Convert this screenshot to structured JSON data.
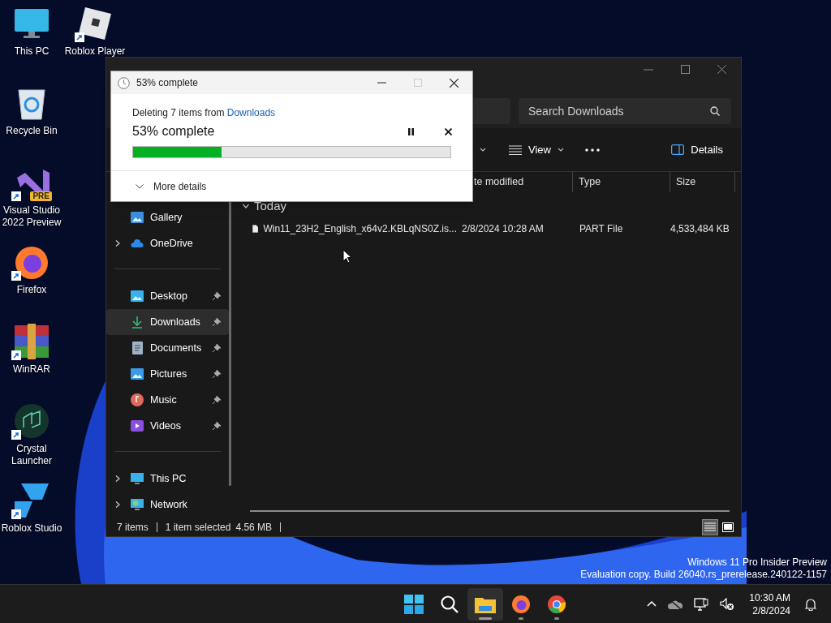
{
  "desktop_columns": [
    [
      {
        "label": "This PC",
        "kind": "pc",
        "shortcut": false
      },
      {
        "label": "Recycle Bin",
        "kind": "bin",
        "shortcut": false
      },
      {
        "label": "Visual Studio 2022 Preview",
        "kind": "vs",
        "shortcut": true,
        "badge": "PRE"
      },
      {
        "label": "Firefox",
        "kind": "firefox",
        "shortcut": true
      },
      {
        "label": "WinRAR",
        "kind": "winrar",
        "shortcut": true
      },
      {
        "label": "Crystal Launcher",
        "kind": "crystal",
        "shortcut": true
      },
      {
        "label": "Roblox Studio",
        "kind": "studio",
        "shortcut": true
      }
    ],
    [
      {
        "label": "Roblox Player",
        "kind": "roblox",
        "shortcut": true
      }
    ]
  ],
  "explorer": {
    "search": {
      "placeholder": "Search Downloads"
    },
    "toolbar": [
      {
        "kind": "caret"
      },
      {
        "kind": "view",
        "label": "View"
      },
      {
        "kind": "more"
      },
      {
        "kind": "details",
        "label": "Details"
      }
    ],
    "sidebar": [
      [
        {
          "label": "Gallery",
          "kind": "gallery",
          "expandable": false,
          "pinned": false,
          "selected": false
        },
        {
          "label": "OneDrive",
          "kind": "cloud",
          "expandable": true,
          "pinned": false,
          "selected": false
        }
      ],
      [
        {
          "label": "Desktop",
          "kind": "desktop",
          "expandable": false,
          "pinned": true,
          "selected": false
        },
        {
          "label": "Downloads",
          "kind": "download",
          "expandable": false,
          "pinned": true,
          "selected": true
        },
        {
          "label": "Documents",
          "kind": "document",
          "expandable": false,
          "pinned": true,
          "selected": false
        },
        {
          "label": "Pictures",
          "kind": "picture",
          "expandable": false,
          "pinned": true,
          "selected": false
        },
        {
          "label": "Music",
          "kind": "music",
          "expandable": false,
          "pinned": true,
          "selected": false
        },
        {
          "label": "Videos",
          "kind": "video",
          "expandable": false,
          "pinned": true,
          "selected": false
        }
      ],
      [
        {
          "label": "This PC",
          "kind": "pc",
          "expandable": true,
          "pinned": false,
          "selected": false
        },
        {
          "label": "Network",
          "kind": "network",
          "expandable": true,
          "pinned": false,
          "selected": false
        }
      ]
    ],
    "columns": [
      "te modified",
      "Type",
      "Size"
    ],
    "group": {
      "label": "Today",
      "expanded": true
    },
    "files": [
      {
        "name": "Win11_23H2_English_x64v2.KBLqNS0Z.is...",
        "date": "2/8/2024 10:28 AM",
        "type": "PART File",
        "size": "4,533,484 KB"
      }
    ],
    "status": [
      "7 items",
      "1 item selected",
      "4.56 MB"
    ],
    "views": [
      {
        "kind": "details",
        "selected": true
      },
      {
        "kind": "tiles",
        "selected": false
      }
    ]
  },
  "dialog": {
    "title": "53% complete",
    "message": "Deleting 7 items from ",
    "source_link": "Downloads",
    "heading": "53% complete",
    "level": 0.28,
    "more": "More details"
  },
  "watermark": [
    "Windows 11 Pro Insider Preview",
    "Evaluation copy. Build 26040.rs_prerelease.240122-1157"
  ],
  "taskbar": {
    "apps": [
      {
        "kind": "start",
        "running": false,
        "active": false
      },
      {
        "kind": "search",
        "running": false,
        "active": false
      },
      {
        "kind": "explorer",
        "running": true,
        "active": true
      },
      {
        "kind": "firefox",
        "running": true,
        "active": false
      },
      {
        "kind": "chrome",
        "running": true,
        "active": false
      }
    ],
    "time": "10:30 AM",
    "date": "2/8/2024"
  }
}
